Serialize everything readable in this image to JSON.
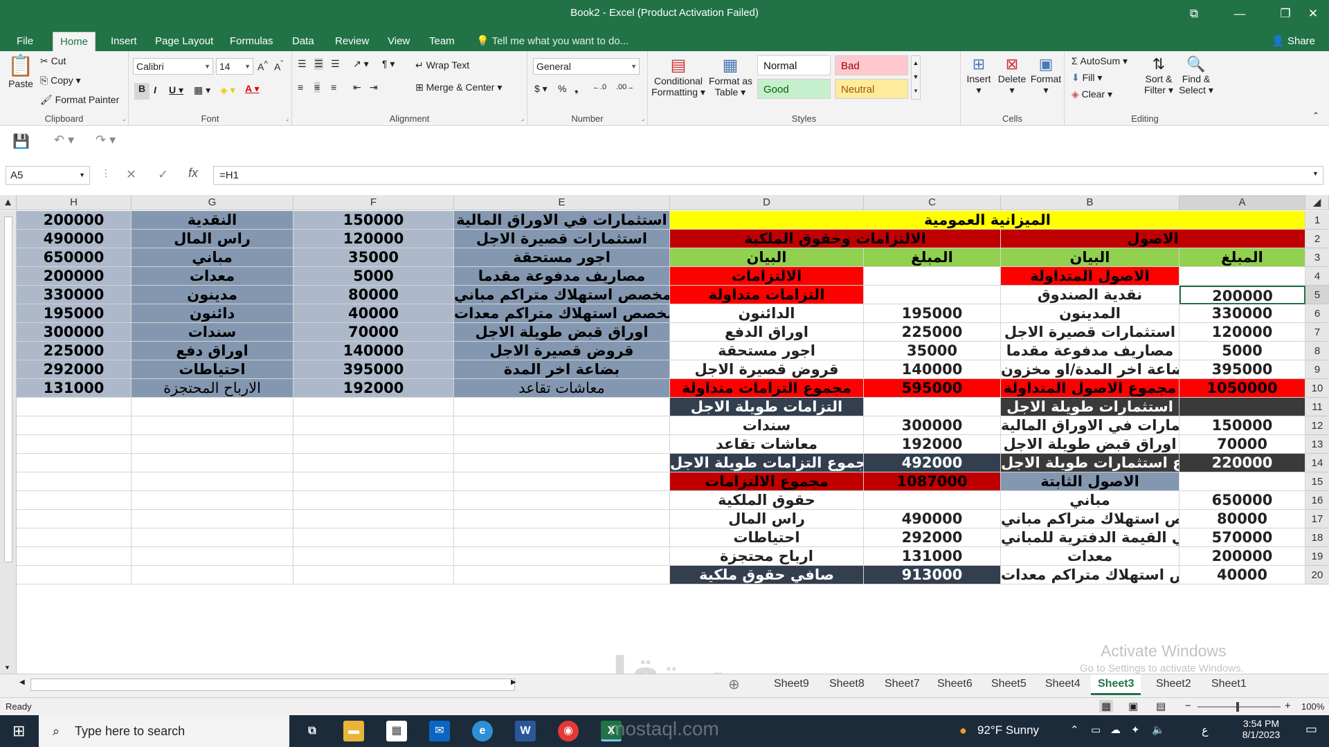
{
  "window": {
    "title": "Book2 - Excel (Product Activation Failed)"
  },
  "tabs": [
    "File",
    "Home",
    "Insert",
    "Page Layout",
    "Formulas",
    "Data",
    "Review",
    "View",
    "Team"
  ],
  "tell_me": "Tell me what you want to do...",
  "share": "Share",
  "ribbon": {
    "clipboard": {
      "paste": "Paste",
      "cut": "Cut",
      "copy": "Copy",
      "format_painter": "Format Painter",
      "label": "Clipboard"
    },
    "font": {
      "name": "Calibri",
      "size": "14",
      "label": "Font"
    },
    "alignment": {
      "wrap": "Wrap Text",
      "merge": "Merge & Center",
      "label": "Alignment"
    },
    "number": {
      "format": "General",
      "label": "Number"
    },
    "styles": {
      "conditional": "Conditional",
      "conditional2": "Formatting",
      "format_as": "Format as",
      "format_as2": "Table",
      "normal": "Normal",
      "bad": "Bad",
      "good": "Good",
      "neutral": "Neutral",
      "label": "Styles"
    },
    "cells": {
      "insert": "Insert",
      "delete": "Delete",
      "format": "Format",
      "label": "Cells"
    },
    "editing": {
      "autosum": "AutoSum",
      "fill": "Fill",
      "clear": "Clear",
      "sort": "Sort &",
      "sort2": "Filter",
      "find": "Find &",
      "find2": "Select",
      "label": "Editing"
    }
  },
  "formula_bar": {
    "name_box": "A5",
    "formula": "=H1"
  },
  "columns": [
    "H",
    "G",
    "F",
    "E",
    "D",
    "C",
    "B",
    "A"
  ],
  "rows": [
    "1",
    "2",
    "3",
    "4",
    "5",
    "6",
    "7",
    "8",
    "9",
    "10",
    "11",
    "12",
    "13",
    "14",
    "15",
    "16",
    "17",
    "18",
    "19",
    "20"
  ],
  "cells": {
    "H": [
      "200000",
      "490000",
      "650000",
      "200000",
      "330000",
      "195000",
      "300000",
      "225000",
      "292000",
      "131000"
    ],
    "G": [
      "النقدية",
      "راس المال",
      "مباني",
      "معدات",
      "مدينون",
      "دائنون",
      "سندات",
      "اوراق دفع",
      "احتياطات",
      "الارباح المحتجزة"
    ],
    "F": [
      "150000",
      "120000",
      "35000",
      "5000",
      "80000",
      "40000",
      "70000",
      "140000",
      "395000",
      "192000"
    ],
    "E": [
      "استثمارات في الاوراق المالية",
      "استثمارات قصيرة الاجل",
      "اجور مستحقة",
      "مصاريف مدفوعة مقدما",
      "مخصص استهلاك متراكم مباني",
      "مخصص استهلاك متراكم معدات",
      "اوراق قبض طويلة الاجل",
      "قروض قصيرة الاجل",
      "بضاعة اخر المدة",
      "معاشات تقاعد"
    ],
    "title": "الميزانية العمومية",
    "assets_header": "الاصول",
    "liab_header": "الالتزامات وحقوق الملكية",
    "D": [
      "البيان",
      "الالتزامات",
      "التزامات متداولة",
      "الدائنون",
      "اوراق الدفع",
      "اجور مستحقة",
      "قروض قصيرة الاجل",
      "مجموع التزامات متداولة",
      "التزامات طويلة الاجل",
      "سندات",
      "معاشات تقاعد",
      "مجموع التزامات طويلة الاجل",
      "مجموع الالتزامات",
      "حقوق الملكية",
      "راس المال",
      "احتياطات",
      "ارباح محتجزة",
      "صافي حقوق ملكية"
    ],
    "C": [
      "المبلغ",
      "",
      "",
      "195000",
      "225000",
      "35000",
      "140000",
      "595000",
      "",
      "300000",
      "192000",
      "492000",
      "1087000",
      "",
      "490000",
      "292000",
      "131000",
      "913000"
    ],
    "B": [
      "البيان",
      "الاصول المتداولة",
      "نقدية الصندوق",
      "المدينون",
      "استثمارات قصيرة الاجل",
      "مصاريف مدفوعة مقدما",
      "بضاعة اخر المدة/او مخزون",
      "مجموع الاصول المتداولة",
      "استثمارات طويلة الاجل",
      "استثمارات في الاوراق المالية",
      "اوراق قبض طويلة الاجل",
      "مجموع استثمارات طويلة الاجل",
      "الاصول الثابتة",
      "مباني",
      "مخصص استهلاك متراكم مباني",
      "صافي القيمة الدفترية للمباني",
      "معدات",
      "مخصص استهلاك متراكم معدات"
    ],
    "A": [
      "المبلغ",
      "",
      "200000",
      "330000",
      "120000",
      "5000",
      "395000",
      "1050000",
      "",
      "150000",
      "70000",
      "220000",
      "",
      "650000",
      "80000",
      "570000",
      "200000",
      "40000"
    ]
  },
  "sheets": [
    "Sheet9",
    "Sheet8",
    "Sheet7",
    "Sheet6",
    "Sheet5",
    "Sheet4",
    "Sheet3",
    "Sheet2",
    "Sheet1"
  ],
  "active_sheet": "Sheet3",
  "status": {
    "ready": "Ready",
    "zoom": "100%"
  },
  "watermark": {
    "activate": "Activate Windows",
    "activate2": "Go to Settings to activate Windows.",
    "site": "mostaql.com",
    "site_ar": "مستقل"
  },
  "taskbar": {
    "search": "Type here to search",
    "weather": "92°F  Sunny",
    "lang": "ع",
    "time": "3:54 PM",
    "date": "8/1/2023"
  },
  "colors": {
    "excel_green": "#217346",
    "yellow": "#ffff00",
    "dark_red": "#c00000",
    "red": "#ff0000",
    "light_green": "#92d050",
    "slate": "#8497b0",
    "light_slate": "#adb9ca",
    "dark_slate": "#333f4f",
    "dark_gray": "#3a3a3a"
  }
}
